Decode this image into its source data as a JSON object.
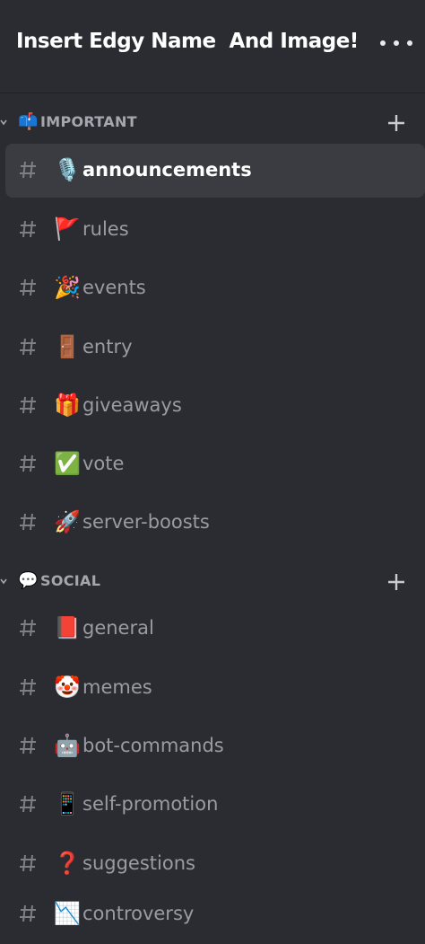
{
  "server": {
    "name": "Insert Edgy Name  And Image!",
    "more_icon": "ellipsis-icon"
  },
  "colors": {
    "background": "#2b2c31",
    "selected_row": "#3a3c42",
    "channel_text": "#9a9ca3",
    "selected_text": "#ffffff"
  },
  "categories": [
    {
      "emoji": "📫",
      "label": "IMPORTANT",
      "channels": [
        {
          "emoji": "🎙️",
          "name": "announcements",
          "selected": true
        },
        {
          "emoji": "🚩",
          "name": "rules"
        },
        {
          "emoji": "🎉",
          "name": "events"
        },
        {
          "emoji": "🚪",
          "name": "entry"
        },
        {
          "emoji": "🎁",
          "name": "giveaways"
        },
        {
          "emoji": "✅",
          "name": "vote"
        },
        {
          "emoji": "🚀",
          "name": "server-boosts"
        }
      ]
    },
    {
      "emoji": "💬",
      "label": "SOCIAL",
      "channels": [
        {
          "emoji": "📕",
          "name": "general"
        },
        {
          "emoji": "🤡",
          "name": "memes"
        },
        {
          "emoji": "🤖",
          "name": "bot-commands"
        },
        {
          "emoji": "📱",
          "name": "self-promotion"
        },
        {
          "emoji": "❓",
          "name": "suggestions"
        },
        {
          "emoji": "📉",
          "name": "controversy"
        }
      ]
    }
  ]
}
